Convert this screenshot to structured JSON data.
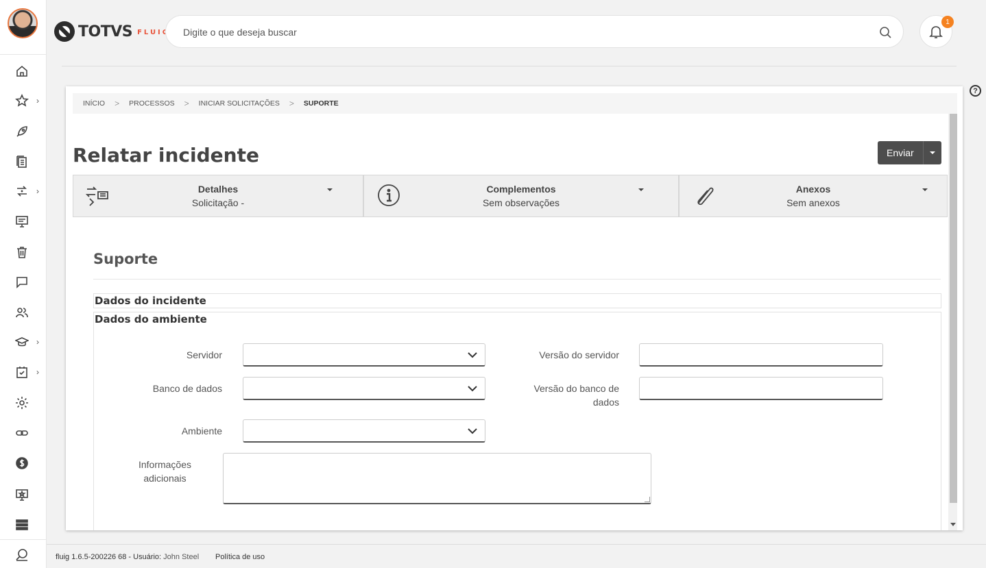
{
  "header": {
    "logo_text": "TOTVS",
    "logo_sub": "FLUIG",
    "search_placeholder": "Digite o que deseja buscar",
    "notifications_count": "1"
  },
  "sidebar": {
    "items": [
      {
        "icon": "home-icon"
      },
      {
        "icon": "star-icon",
        "has_submenu": true
      },
      {
        "icon": "rocket-icon"
      },
      {
        "icon": "documents-icon"
      },
      {
        "icon": "workflow-icon",
        "has_submenu": true
      },
      {
        "icon": "monitor-icon"
      },
      {
        "icon": "trash-icon"
      },
      {
        "icon": "chat-icon"
      },
      {
        "icon": "users-icon"
      },
      {
        "icon": "graduation-icon",
        "has_submenu": true
      },
      {
        "icon": "tasks-icon",
        "has_submenu": true
      },
      {
        "icon": "gear-icon"
      },
      {
        "icon": "link-icon"
      },
      {
        "icon": "dollar-icon"
      },
      {
        "icon": "screen-star-icon"
      },
      {
        "icon": "list-icon"
      },
      {
        "icon": "search-bottom-icon"
      }
    ]
  },
  "breadcrumb": {
    "items": [
      "INÍCIO",
      "PROCESSOS",
      "INICIAR SOLICITAÇÕES"
    ],
    "current": "SUPORTE",
    "separator": ">"
  },
  "page": {
    "title": "Relatar incidente",
    "send_label": "Enviar"
  },
  "tabs": [
    {
      "title": "Detalhes",
      "subtitle": "Solicitação -"
    },
    {
      "title": "Complementos",
      "subtitle": "Sem observações"
    },
    {
      "title": "Anexos",
      "subtitle": "Sem anexos"
    }
  ],
  "form": {
    "title": "Suporte",
    "section_incident": "Dados do incidente",
    "section_environment": "Dados do ambiente",
    "fields": {
      "servidor": {
        "label": "Servidor",
        "value": ""
      },
      "versao_servidor": {
        "label": "Versão do servidor",
        "value": ""
      },
      "banco_dados": {
        "label": "Banco de dados",
        "value": ""
      },
      "versao_banco_line1": "Versão do banco de",
      "versao_banco_line2": "dados",
      "ambiente": {
        "label": "Ambiente",
        "value": ""
      },
      "informacoes_line1": "Informações",
      "informacoes_line2": "adicionais"
    }
  },
  "footer": {
    "version": "fluig 1.6.5-200226 68 - Usuário:",
    "user": "John Steel",
    "policy": "Política de uso"
  },
  "colors": {
    "accent": "#e8543b",
    "badge": "#f58220",
    "button": "#4d4d4d"
  }
}
